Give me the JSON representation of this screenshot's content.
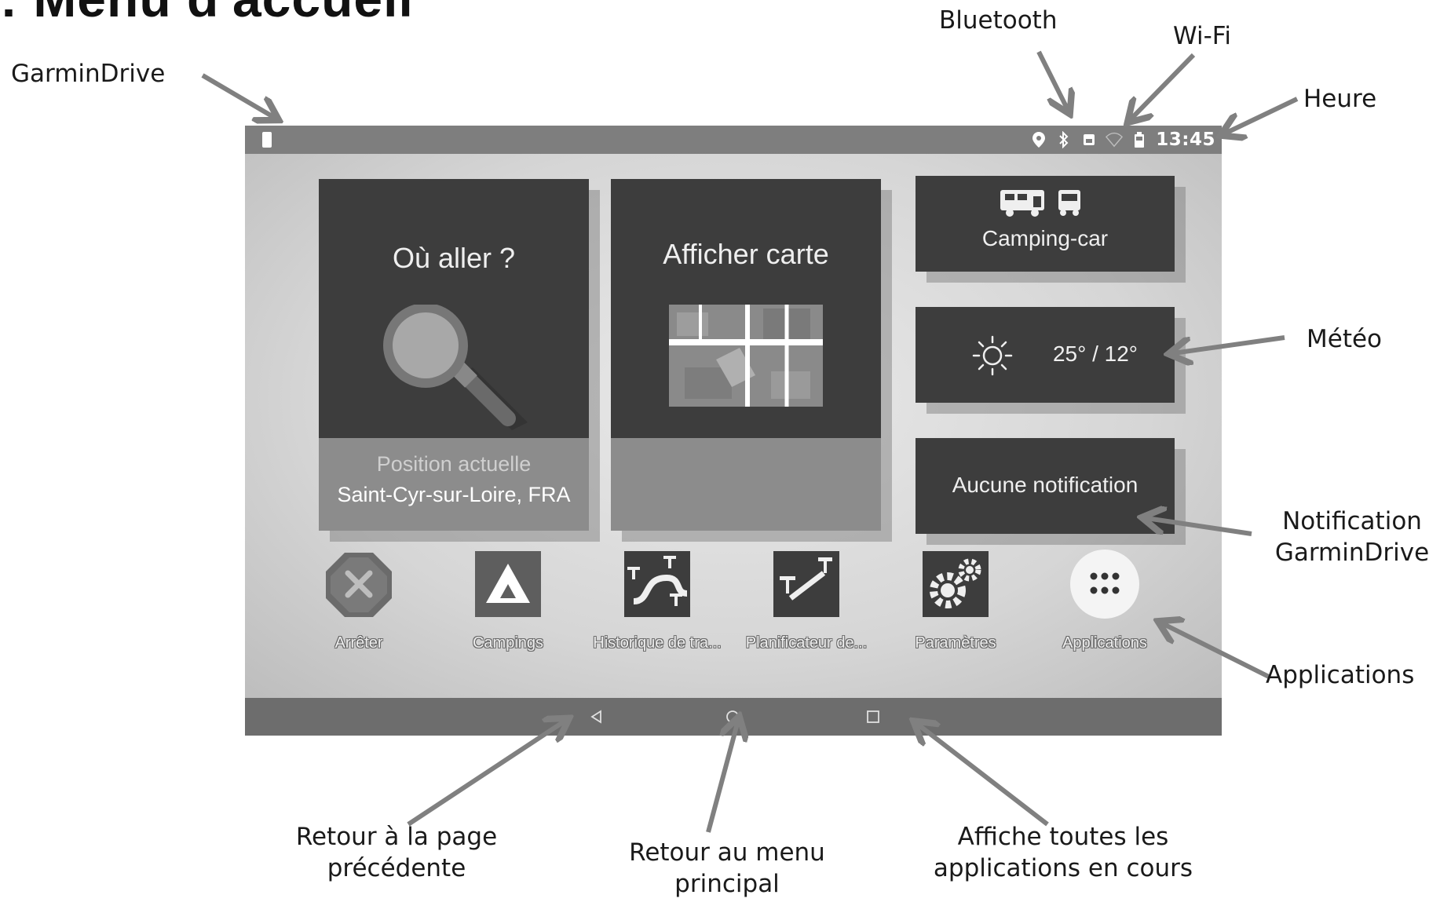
{
  "heading": ": Menu d'accueil",
  "callouts": {
    "garmindrive": "GarminDrive",
    "bluetooth": "Bluetooth",
    "wifi": "Wi-Fi",
    "heure": "Heure",
    "meteo": "Météo",
    "notification_line1": "Notification",
    "notification_line2": "GarminDrive",
    "applications": "Applications",
    "back_line1": "Retour à la page",
    "back_line2": "précédente",
    "home_line1": "Retour au menu",
    "home_line2": "principal",
    "recent_line1": "Affiche toutes les",
    "recent_line2": "applications en cours"
  },
  "status_bar": {
    "time": "13:45",
    "icons": [
      "location-icon",
      "bluetooth-icon",
      "sim-icon",
      "wifi-icon",
      "battery-icon"
    ]
  },
  "tiles": {
    "where_to": {
      "title": "Où aller ?",
      "position_label": "Position actuelle",
      "position_value": "Saint-Cyr-sur-Loire, FRA"
    },
    "map": {
      "title": "Afficher carte"
    },
    "vehicle": {
      "label": "Camping-car"
    },
    "weather": {
      "label": "25° / 12°"
    },
    "notifications": {
      "label": "Aucune notification"
    }
  },
  "apps": [
    {
      "label": "Arrêter",
      "icon": "stop-icon"
    },
    {
      "label": "Campings",
      "icon": "camping-icon"
    },
    {
      "label": "Historique de tra...",
      "icon": "trip-history-icon"
    },
    {
      "label": "Planificateur de...",
      "icon": "trip-planner-icon"
    },
    {
      "label": "Paramètres",
      "icon": "settings-icon"
    },
    {
      "label": "Applications",
      "icon": "apps-grid-icon"
    }
  ],
  "nav": [
    "back-icon",
    "home-icon",
    "recent-apps-icon"
  ],
  "colors": {
    "tile_dark": "#3d3d3d",
    "tile_footer": "#8c8c8c",
    "status_bar": "#7e7e7e",
    "nav_bar": "#6d6d6d",
    "arrow": "#808080"
  }
}
